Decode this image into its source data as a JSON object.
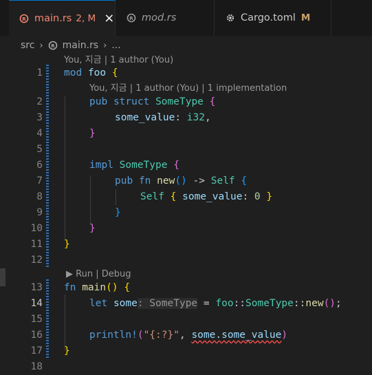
{
  "tabs": [
    {
      "label": "main.rs",
      "status": "2, M",
      "close": "×",
      "icon": "rust-file-icon",
      "active": true
    },
    {
      "label": "mod.rs",
      "status": "",
      "icon": "rust-file-icon",
      "active": false
    },
    {
      "label": "Cargo.toml",
      "status": "M",
      "icon": "gear-icon",
      "active": false
    }
  ],
  "breadcrumb": {
    "folder": "src",
    "sep": "›",
    "file": "main.rs",
    "more": "..."
  },
  "codelens": {
    "blame_mod": "You, 지금 | 1 author (You)",
    "blame_struct": "You, 지금 | 1 author (You) | 1 implementation",
    "run_debug": "▶ Run | Debug"
  },
  "gutter": {
    "line_numbers": [
      "1",
      "2",
      "3",
      "4",
      "5",
      "6",
      "7",
      "8",
      "9",
      "10",
      "11",
      "12",
      "13",
      "14",
      "15",
      "16",
      "17",
      "18"
    ]
  },
  "code": {
    "l1": {
      "kw": "mod",
      "name": "foo",
      "brace": "{"
    },
    "l2": {
      "kw1": "pub",
      "kw2": "struct",
      "type": "SomeType",
      "brace": "{"
    },
    "l3": {
      "field": "some_value",
      "colon": ": ",
      "type": "i32",
      "comma": ","
    },
    "l4": {
      "brace": "}"
    },
    "l6": {
      "kw": "impl",
      "type": "SomeType",
      "brace": "{"
    },
    "l7": {
      "kw1": "pub",
      "kw2": "fn",
      "name": "new",
      "paren": "()",
      "arrow": " -> ",
      "self": "Self",
      "brace": "{"
    },
    "l8": {
      "self": "Self",
      "open": "{",
      "field": "some_value",
      "colon": ": ",
      "num": "0",
      "close": "}"
    },
    "l9": {
      "brace": "}"
    },
    "l10": {
      "brace": "}"
    },
    "l11": {
      "brace": "}"
    },
    "l13": {
      "kw": "fn",
      "name": "main",
      "paren": "()",
      "brace": "{"
    },
    "l14": {
      "kw": "let",
      "var": "some",
      "hint": ": SomeType",
      "eq": " = ",
      "mod": "foo",
      "sep1": "::",
      "type": "SomeType",
      "sep2": "::",
      "fn": "new",
      "paren": "()",
      "semi": ";"
    },
    "l16": {
      "macro": "println!",
      "open": "(",
      "str": "\"{:?}\"",
      "comma": ", ",
      "expr": "some.some_value",
      "close": ")"
    },
    "l17": {
      "brace": "}"
    }
  }
}
